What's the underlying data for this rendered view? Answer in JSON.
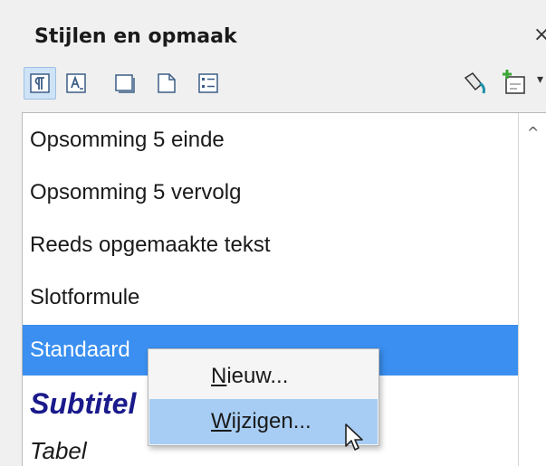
{
  "panel": {
    "title": "Stijlen en opmaak",
    "close_glyph": "×"
  },
  "toolbar": {
    "icons": [
      "paragraph-styles-icon",
      "character-styles-icon",
      "frame-styles-icon",
      "page-styles-icon",
      "list-styles-icon",
      "fill-format-mode-icon",
      "new-style-from-selection-icon"
    ],
    "dropdown_glyph": "▾"
  },
  "styles_list": {
    "items": [
      {
        "label": "Opsomming 5 einde",
        "selected": false
      },
      {
        "label": "Opsomming 5 vervolg",
        "selected": false
      },
      {
        "label": "Reeds opgemaakte tekst",
        "selected": false
      },
      {
        "label": "Slotformule",
        "selected": false
      },
      {
        "label": "Standaard",
        "selected": true
      },
      {
        "label": "Subtitel",
        "selected": false
      },
      {
        "label": "Tabel",
        "selected": false
      }
    ],
    "scroll_up_glyph": "^"
  },
  "context_menu": {
    "items": [
      {
        "label": "Nieuw...",
        "hover": false
      },
      {
        "label": "Wijzigen...",
        "hover": true
      }
    ]
  },
  "colors": {
    "selection": "#3a8ff0",
    "menu_hover": "#a7cdf4",
    "subtitle_text": "#1a1a8c"
  }
}
